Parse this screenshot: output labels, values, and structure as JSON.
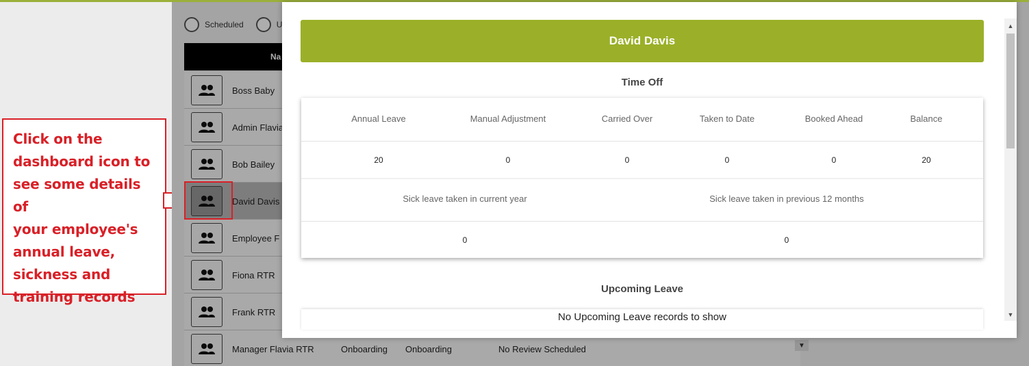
{
  "annotation": {
    "callout_text": "Click on the\ndashboard icon to\nsee some details of\nyour employee's\nannual leave,\nsickness and\ntraining records",
    "accent_color": "#d92027"
  },
  "background": {
    "filters": [
      "Scheduled",
      "U"
    ],
    "table_header": "Na",
    "rows": [
      {
        "name": "Boss Baby"
      },
      {
        "name": "Admin Flavia"
      },
      {
        "name": "Bob Bailey"
      },
      {
        "name": "David Davis",
        "selected": true
      },
      {
        "name": "Employee  F"
      },
      {
        "name": "Fiona RTR"
      },
      {
        "name": "Frank RTR"
      },
      {
        "name": "Manager Flavia RTR",
        "col2": "Onboarding",
        "col3": "Onboarding",
        "col4": "No Review Scheduled"
      }
    ]
  },
  "modal": {
    "employee_name": "David Davis",
    "banner_color": "#9bb028",
    "time_off_title": "Time Off",
    "time_off_headers": [
      "Annual Leave",
      "Manual Adjustment",
      "Carried Over",
      "Taken to Date",
      "Booked Ahead",
      "Balance"
    ],
    "time_off_values": [
      "20",
      "0",
      "0",
      "0",
      "0",
      "20"
    ],
    "sick_headers": [
      "Sick leave taken in current year",
      "Sick leave taken in previous 12 months"
    ],
    "sick_values": [
      "0",
      "0"
    ],
    "upcoming_title": "Upcoming Leave",
    "upcoming_empty": "No Upcoming Leave records to show"
  }
}
